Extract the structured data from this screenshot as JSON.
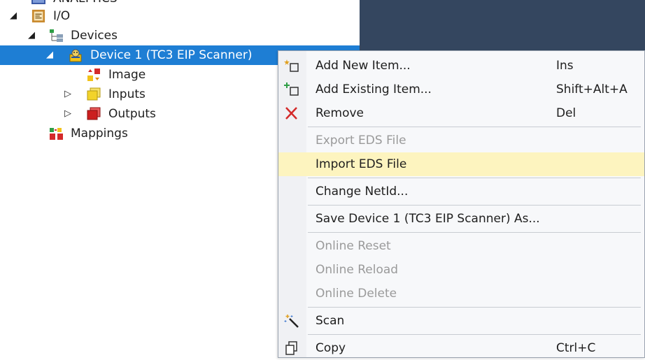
{
  "tree": {
    "items": [
      {
        "label": "ANALYTICS",
        "icon": "analytics-icon"
      },
      {
        "label": "I/O",
        "icon": "io-folder-icon",
        "expander": "◢"
      },
      {
        "label": "Devices",
        "icon": "devices-icon",
        "expander": "◢"
      },
      {
        "label": "Device 1 (TC3 EIP Scanner)",
        "icon": "eip-device-icon",
        "expander": "◢",
        "selected": true
      },
      {
        "label": "Image",
        "icon": "image-icon"
      },
      {
        "label": "Inputs",
        "icon": "inputs-icon",
        "expander": "▷"
      },
      {
        "label": "Outputs",
        "icon": "outputs-icon",
        "expander": "▷"
      },
      {
        "label": "Mappings",
        "icon": "mappings-icon"
      }
    ]
  },
  "context_menu": {
    "items": [
      {
        "label": "Add New Item...",
        "shortcut": "Ins",
        "icon": "add-new-item-icon",
        "enabled": true
      },
      {
        "label": "Add Existing Item...",
        "shortcut": "Shift+Alt+A",
        "icon": "add-existing-item-icon",
        "enabled": true
      },
      {
        "label": "Remove",
        "shortcut": "Del",
        "icon": "remove-icon",
        "enabled": true
      },
      {
        "label": "Export EDS File",
        "shortcut": "",
        "enabled": false
      },
      {
        "label": "Import EDS File",
        "shortcut": "",
        "enabled": true,
        "highlighted": true
      },
      {
        "label": "Change NetId...",
        "shortcut": "",
        "enabled": true
      },
      {
        "label": "Save Device 1 (TC3 EIP Scanner) As...",
        "shortcut": "",
        "enabled": true
      },
      {
        "label": "Online Reset",
        "shortcut": "",
        "enabled": false
      },
      {
        "label": "Online Reload",
        "shortcut": "",
        "enabled": false
      },
      {
        "label": "Online Delete",
        "shortcut": "",
        "enabled": false
      },
      {
        "label": "Scan",
        "shortcut": "",
        "icon": "scan-wand-icon",
        "enabled": true
      },
      {
        "label": "Copy",
        "shortcut": "Ctrl+C",
        "icon": "copy-icon",
        "enabled": true
      }
    ]
  },
  "colors": {
    "selection": "#1e7ed4",
    "menu_highlight": "#fdf4bf",
    "right_pane": "#34465f",
    "disabled_text": "#9a9a9a"
  }
}
